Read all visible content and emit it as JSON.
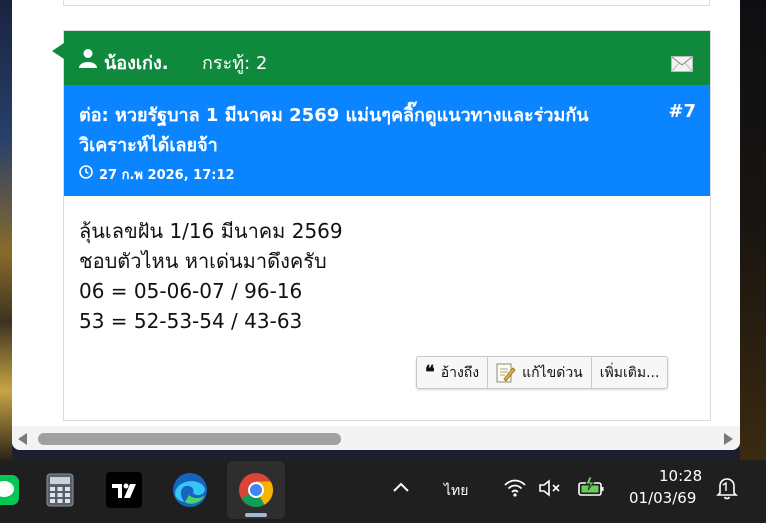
{
  "post": {
    "username": "น้องเก่ง.",
    "posts_label": "กระทู้:",
    "posts_count": "2",
    "title": "ต่อ: หวยรัฐบาล 1 มีนาคม 2569 แม่นๆคลิ๊กดูแนวทางและร่วมกันวิเคราะห์ได้เลยจ้า",
    "post_number": "#7",
    "date": "27 ก.พ 2026, 17:12",
    "body_lines": [
      "ลุ้นเลขฝัน 1/16 มีนาคม 2569",
      "ชอบตัวไหน หาเด่นมาดึงครับ",
      "06 = 05-06-07 / 96-16",
      "53 = 52-53-54 / 43-63"
    ],
    "buttons": {
      "quote": "อ้างถึง",
      "quick_edit": "แก้ไขด่วน",
      "more": "เพิ่มเติม..."
    }
  },
  "colors": {
    "user_header": "#0f8a3c",
    "title_bar": "#0a84ff"
  },
  "taskbar": {
    "apps": [
      "line-app",
      "calculator-app",
      "tradingview-app",
      "edge-app",
      "chrome-app"
    ],
    "language": "ไทย",
    "time": "10:28",
    "date": "01/03/69"
  }
}
